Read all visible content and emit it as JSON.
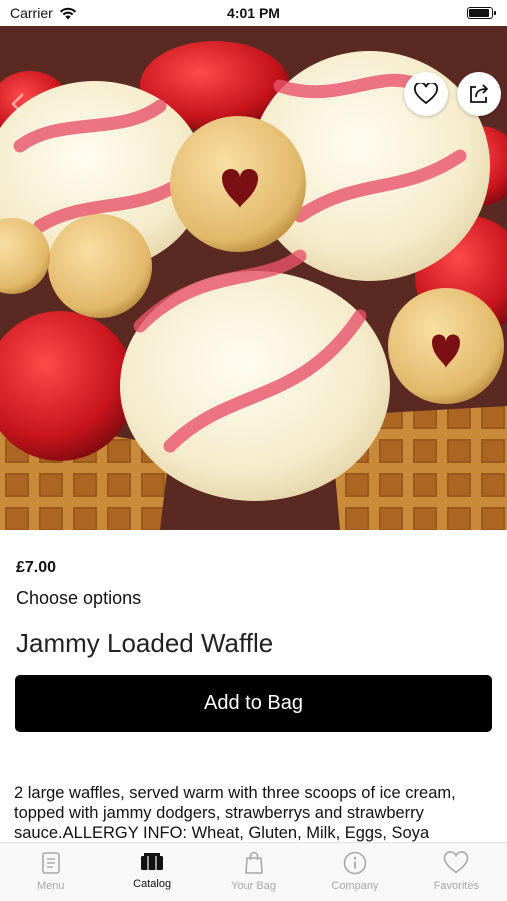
{
  "status_bar": {
    "carrier": "Carrier",
    "time": "4:01 PM",
    "battery_level": 0.95
  },
  "hero": {
    "image_description_icon": "waffle-photo",
    "favorite_icon": "heart-icon",
    "share_icon": "share-icon"
  },
  "product": {
    "price": "£7.00",
    "options_label": "Choose options",
    "title": "Jammy Loaded Waffle",
    "add_button": "Add to Bag",
    "description": "2 large waffles, served warm with three scoops of ice cream, topped with jammy dodgers, strawberrys and strawberry sauce.ALLERGY INFO: Wheat, Gluten, Milk, Eggs, Soya"
  },
  "tabs": [
    {
      "label": "Menu",
      "icon": "menu-book-icon",
      "active": false
    },
    {
      "label": "Catalog",
      "icon": "catalog-icon",
      "active": true
    },
    {
      "label": "Your Bag",
      "icon": "bag-icon",
      "active": false
    },
    {
      "label": "Company",
      "icon": "info-icon",
      "active": false
    },
    {
      "label": "Favorites",
      "icon": "heart-icon",
      "active": false
    }
  ],
  "colors": {
    "accent": "#000000",
    "tab_active": "#111111",
    "tab_inactive": "#a8a8a8"
  }
}
